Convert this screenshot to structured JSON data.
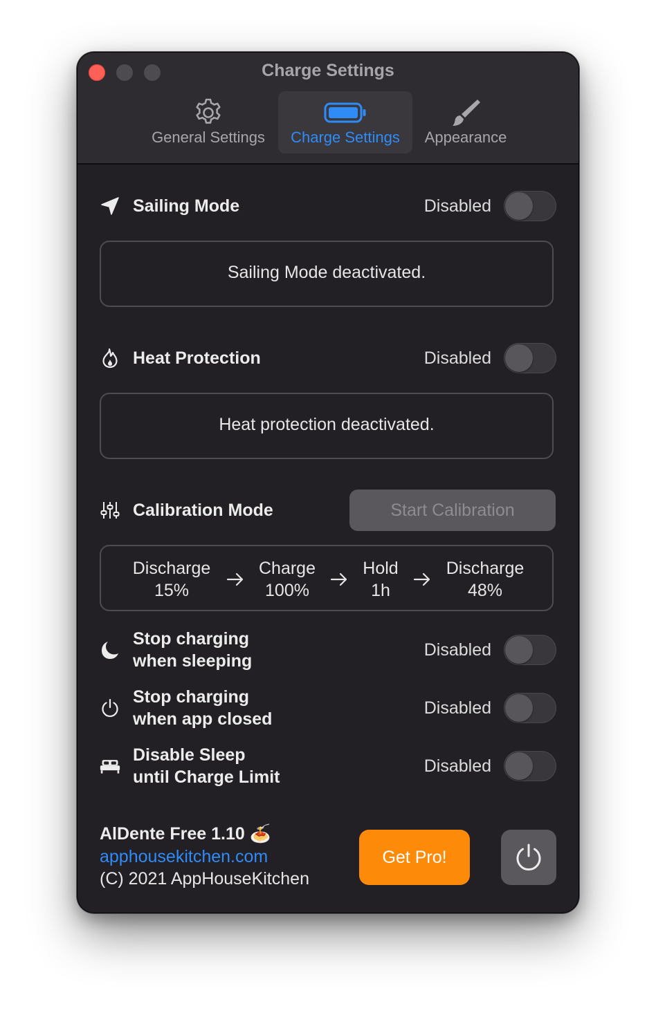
{
  "window": {
    "title": "Charge Settings"
  },
  "tabs": [
    {
      "label": "General Settings",
      "icon": "gear-icon",
      "active": false
    },
    {
      "label": "Charge Settings",
      "icon": "battery-icon",
      "active": true
    },
    {
      "label": "Appearance",
      "icon": "paintbrush-icon",
      "active": false
    }
  ],
  "sailing": {
    "title": "Sailing Mode",
    "status": "Disabled",
    "enabled": false,
    "message": "Sailing Mode deactivated.",
    "icon": "location-arrow-icon"
  },
  "heat": {
    "title": "Heat Protection",
    "status": "Disabled",
    "enabled": false,
    "message": "Heat protection deactivated.",
    "icon": "flame-icon"
  },
  "calibration": {
    "title": "Calibration Mode",
    "button": "Start Calibration",
    "icon": "sliders-icon",
    "steps": [
      {
        "line1": "Discharge",
        "line2": "15%"
      },
      {
        "line1": "Charge",
        "line2": "100%"
      },
      {
        "line1": "Hold",
        "line2": "1h"
      },
      {
        "line1": "Discharge",
        "line2": "48%"
      }
    ]
  },
  "sleeping": {
    "line1": "Stop charging",
    "line2": "when sleeping",
    "status": "Disabled",
    "enabled": false,
    "icon": "moon-icon"
  },
  "app_closed": {
    "line1": "Stop charging",
    "line2": "when app closed",
    "status": "Disabled",
    "enabled": false,
    "icon": "power-icon"
  },
  "disable_sleep": {
    "line1": "Disable Sleep",
    "line2": "until Charge Limit",
    "status": "Disabled",
    "enabled": false,
    "icon": "bed-icon"
  },
  "footer": {
    "name": "AlDente Free 1.10",
    "emoji": "🍝",
    "link": "apphousekitchen.com",
    "copyright": "(C) 2021 AppHouseKitchen",
    "pro_button": "Get Pro!",
    "quit_icon": "power-icon"
  },
  "colors": {
    "accent": "#2f8cf7",
    "pro": "#fe8a0a",
    "close": "#fe5f57",
    "background": "#221f25"
  }
}
